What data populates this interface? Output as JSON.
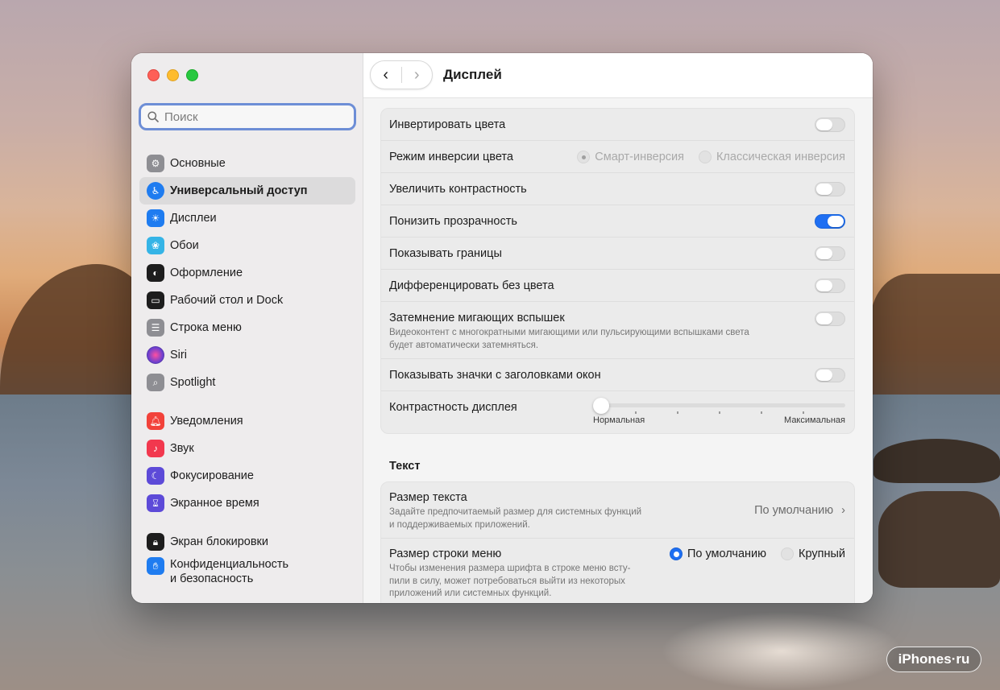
{
  "watermark": "iPhones·ru",
  "sidebar": {
    "search_placeholder": "Поиск",
    "items": [
      {
        "label": "Основные",
        "icon": "gear-icon",
        "color": "#8e8e93"
      },
      {
        "label": "Универсальный доступ",
        "icon": "accessibility-icon",
        "color": "#1f7cf0",
        "active": true
      },
      {
        "label": "Дисплеи",
        "icon": "sun-icon",
        "color": "#1f7cf0"
      },
      {
        "label": "Обои",
        "icon": "flower-icon",
        "color": "#35b4e6"
      },
      {
        "label": "Оформление",
        "icon": "appearance-icon",
        "color": "#1d1d1d"
      },
      {
        "label": "Рабочий стол и Dock",
        "icon": "dock-icon",
        "color": "#1d1d1d"
      },
      {
        "label": "Строка меню",
        "icon": "menubar-icon",
        "color": "#8e8e93"
      },
      {
        "label": "Siri",
        "icon": "siri-icon",
        "color": "#6a3fd0"
      },
      {
        "label": "Spotlight",
        "icon": "magnifier-icon",
        "color": "#8e8e93"
      },
      {
        "label": "Уведомления",
        "icon": "bell-icon",
        "color": "#f2423a"
      },
      {
        "label": "Звук",
        "icon": "speaker-icon",
        "color": "#f2384e"
      },
      {
        "label": "Фокусирование",
        "icon": "moon-icon",
        "color": "#5d4ad8"
      },
      {
        "label": "Экранное время",
        "icon": "hourglass-icon",
        "color": "#5d4ad8"
      },
      {
        "label": "Экран блокировки",
        "icon": "lock-icon",
        "color": "#1d1d1d"
      },
      {
        "label": "Конфиденциальность",
        "label2": "и безопасность",
        "icon": "hand-icon",
        "color": "#1f7cf0"
      }
    ]
  },
  "header": {
    "title": "Дисплей",
    "back": "‹",
    "forward": "›"
  },
  "display": {
    "invert_colors": {
      "label": "Инвертировать цвета",
      "on": false
    },
    "invert_mode": {
      "label": "Режим инверсии цвета",
      "option1": "Смарт-инверсия",
      "option2": "Классическая инверсия"
    },
    "increase_contrast": {
      "label": "Увеличить контрастность",
      "on": false
    },
    "reduce_transparency": {
      "label": "Понизить прозрачность",
      "on": true
    },
    "show_borders": {
      "label": "Показывать границы",
      "on": false
    },
    "differentiate": {
      "label": "Дифференцировать без цвета",
      "on": false
    },
    "dim_flashing": {
      "label": "Затемнение мигающих вспышек",
      "desc1": "Видеоконтент с многократными мигающими или пульсирующими вспышками света",
      "desc2": "будет автоматически затемняться.",
      "on": false
    },
    "window_icons": {
      "label": "Показывать значки с заголовками окон",
      "on": false
    },
    "contrast": {
      "label": "Контрастность дисплея",
      "min_label": "Нормальная",
      "max_label": "Максимальная",
      "value": 0
    }
  },
  "text_section": {
    "title": "Текст",
    "text_size": {
      "label": "Размер текста",
      "desc1": "Задайте предпочитаемый размер для системных функций",
      "desc2": "и поддерживаемых приложений.",
      "value": "По умолчанию"
    },
    "menubar_size": {
      "label": "Размер строки меню",
      "desc1": "Чтобы изменения размера шрифта в строке меню всту-",
      "desc2": "пили в силу, может потребоваться выйти из некоторых",
      "desc3": "приложений или системных функций.",
      "option1": "По умолчанию",
      "option2": "Крупный"
    }
  }
}
